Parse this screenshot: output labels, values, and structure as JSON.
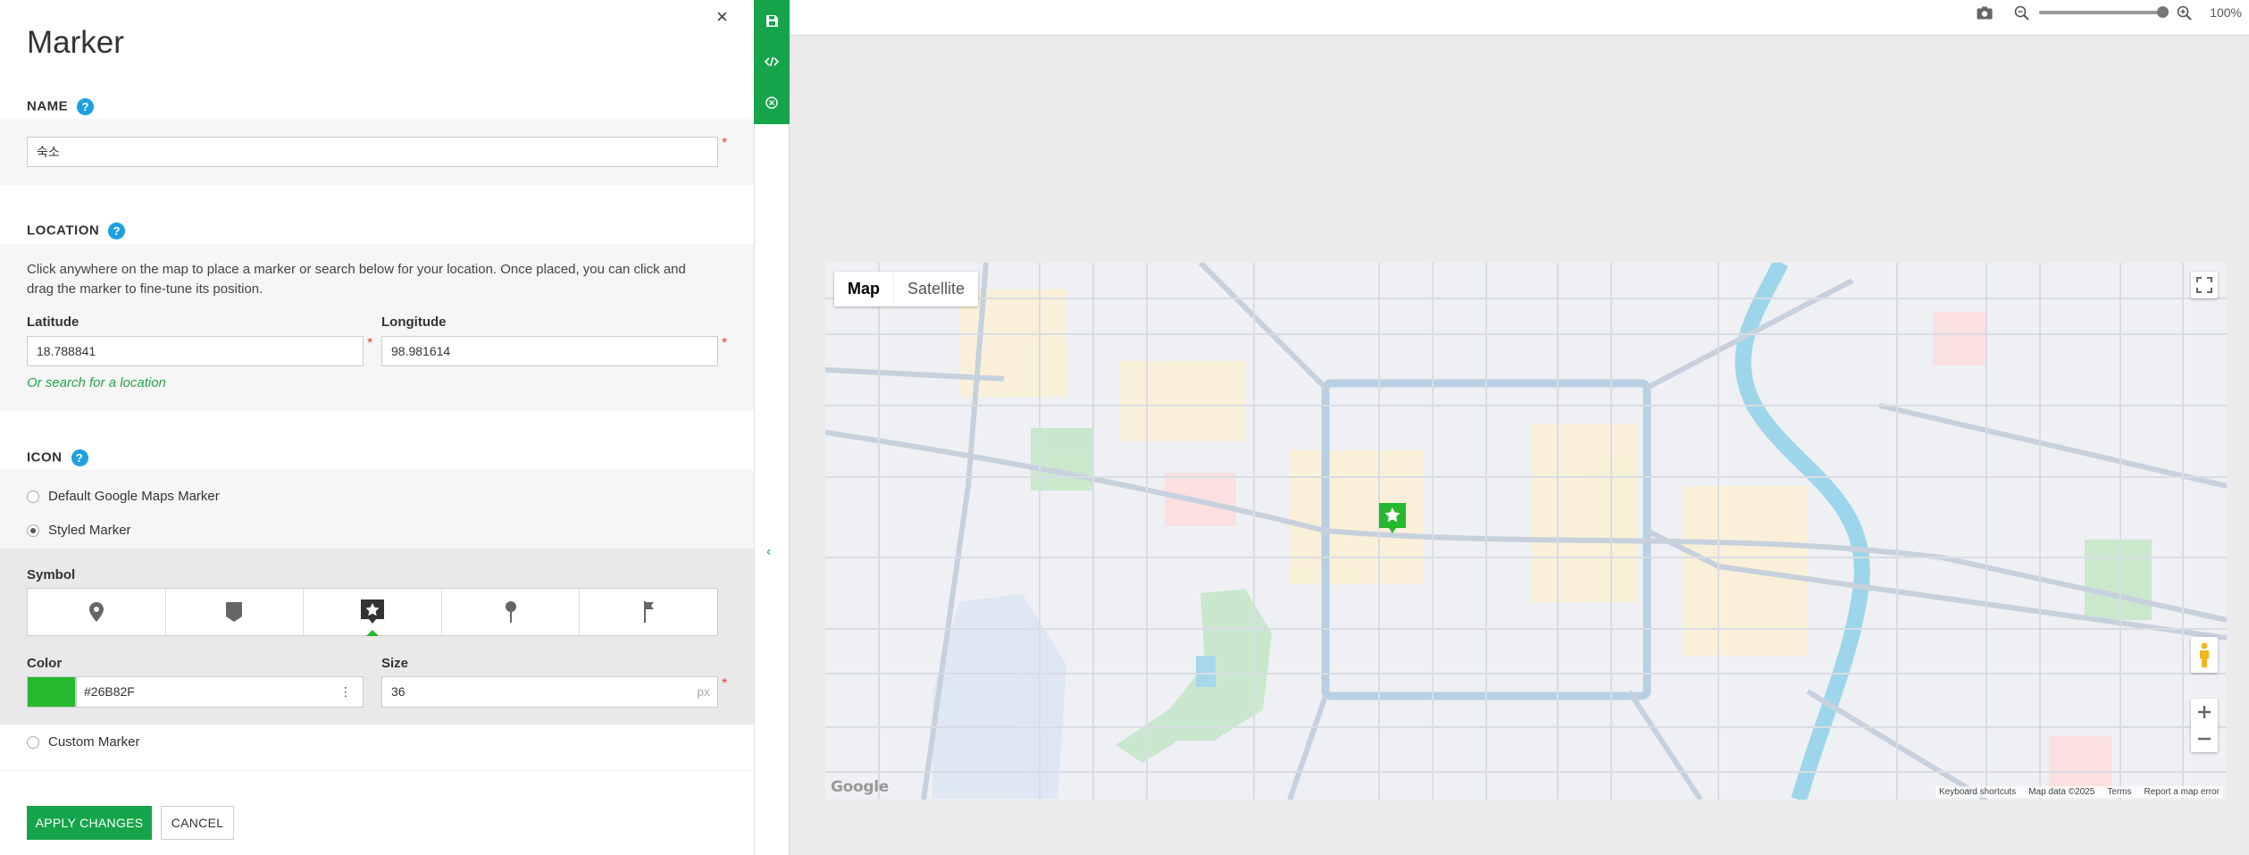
{
  "panel": {
    "title": "Marker",
    "close_glyph": "×",
    "name": {
      "label": "NAME",
      "help": "?",
      "value": "숙소",
      "required": "*"
    },
    "location": {
      "label": "LOCATION",
      "help": "?",
      "description": "Click anywhere on the map to place a marker or search below for your location. Once placed, you can click and drag the marker to fine-tune its position.",
      "latitude_label": "Latitude",
      "latitude_value": "18.788841",
      "longitude_label": "Longitude",
      "longitude_value": "98.981614",
      "required": "*",
      "search_link": "Or search for a location"
    },
    "icon": {
      "label": "ICON",
      "help": "?",
      "options": [
        {
          "label": "Default Google Maps Marker",
          "selected": false
        },
        {
          "label": "Styled Marker",
          "selected": true
        },
        {
          "label": "Custom Marker",
          "selected": false
        }
      ],
      "symbol_label": "Symbol",
      "symbols": [
        {
          "icon": "map-pin-icon",
          "selected": false
        },
        {
          "icon": "shield-marker-icon",
          "selected": false
        },
        {
          "icon": "star-square-icon",
          "selected": true
        },
        {
          "icon": "round-pin-icon",
          "selected": false
        },
        {
          "icon": "flag-icon",
          "selected": false
        }
      ],
      "color_label": "Color",
      "color_value": "#26B82F",
      "color_menu_glyph": "⋮",
      "size_label": "Size",
      "size_value": "36",
      "size_unit": "px",
      "required": "*"
    },
    "apply_label": "APPLY CHANGES",
    "cancel_label": "CANCEL"
  },
  "side_toolbar": {
    "items": [
      "save-icon",
      "code-icon",
      "close-circle-icon"
    ],
    "collapse_glyph": "‹"
  },
  "topbar": {
    "zoom_level": "100%",
    "zoom_fraction": 0.96
  },
  "map": {
    "type_map": "Map",
    "type_satellite": "Satellite",
    "logo": "Google",
    "attribution": {
      "shortcuts": "Keyboard shortcuts",
      "data": "Map data ©2025",
      "terms": "Terms",
      "report": "Report a map error"
    },
    "marker_color": "#26B82F"
  },
  "colors": {
    "accent": "#16a44a",
    "help": "#1ea0e0",
    "required": "#e0443a"
  }
}
